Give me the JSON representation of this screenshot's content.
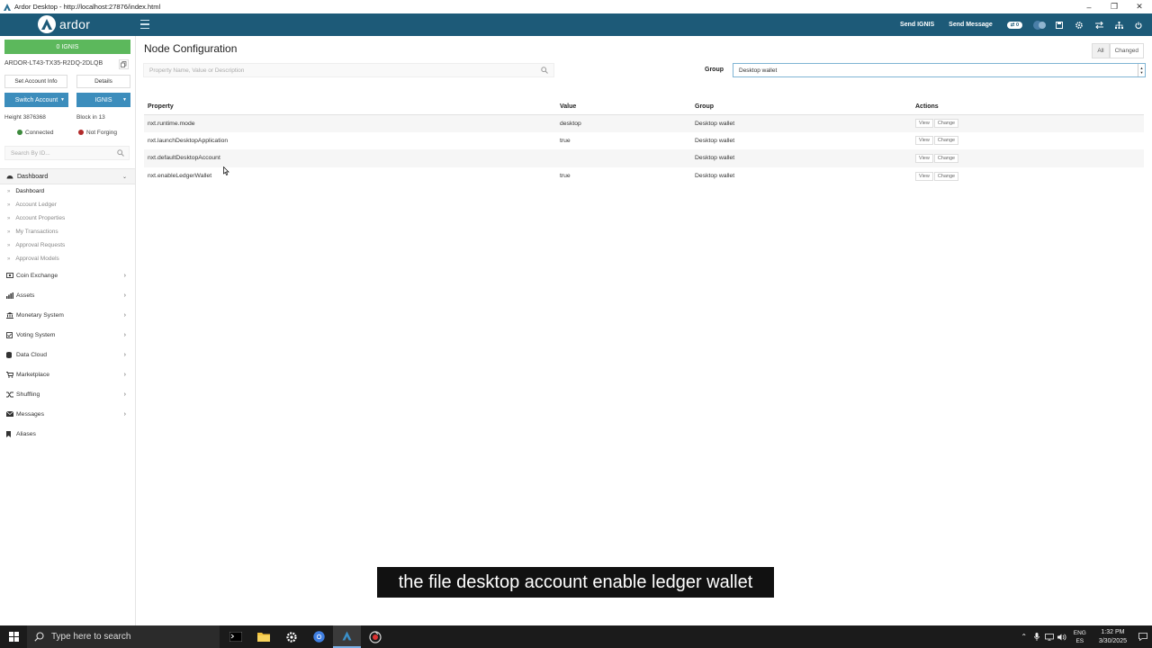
{
  "window": {
    "title": "Ardor Desktop - http://localhost:27876/index.html"
  },
  "navbar": {
    "brand": "ardor",
    "send_ignis": "Send IGNIS",
    "send_message": "Send Message",
    "badge": "0"
  },
  "sidebar": {
    "balance": "0 IGNIS",
    "account": "ARDOR-LT43-TX35-R2DQ-2DLQB",
    "set_account_info": "Set Account Info",
    "details": "Details",
    "switch_account": "Switch Account",
    "chain": "IGNIS",
    "height": "Height 3876368",
    "block_in": "Block in 13",
    "connected": "Connected",
    "not_forging": "Not Forging",
    "search_placeholder": "Search By ID...",
    "dashboard_head": "Dashboard",
    "dashboard_items": [
      "Dashboard",
      "Account Ledger",
      "Account Properties",
      "My Transactions",
      "Approval Requests",
      "Approval Models"
    ],
    "menu": [
      {
        "label": "Coin Exchange",
        "icon": "exchange-icon"
      },
      {
        "label": "Assets",
        "icon": "bar-chart-icon"
      },
      {
        "label": "Monetary System",
        "icon": "bank-icon"
      },
      {
        "label": "Voting System",
        "icon": "checkbox-icon"
      },
      {
        "label": "Data Cloud",
        "icon": "database-icon"
      },
      {
        "label": "Marketplace",
        "icon": "cart-icon"
      },
      {
        "label": "Shuffling",
        "icon": "shuffle-icon"
      },
      {
        "label": "Messages",
        "icon": "envelope-icon"
      },
      {
        "label": "Aliases",
        "icon": "bookmark-icon"
      }
    ]
  },
  "main": {
    "title": "Node Configuration",
    "filter_all": "All",
    "filter_changed": "Changed",
    "search_placeholder": "Property Name, Value or Description",
    "group_label": "Group",
    "group_value": "Desktop wallet",
    "columns": {
      "property": "Property",
      "value": "Value",
      "group": "Group",
      "actions": "Actions"
    },
    "view_label": "View",
    "change_label": "Change",
    "rows": [
      {
        "property": "nxt.runtime.mode",
        "value": "desktop",
        "group": "Desktop wallet"
      },
      {
        "property": "nxt.launchDesktopApplication",
        "value": "true",
        "group": "Desktop wallet"
      },
      {
        "property": "nxt.defaultDesktopAccount",
        "value": "",
        "group": "Desktop wallet"
      },
      {
        "property": "nxt.enableLedgerWallet",
        "value": "true",
        "group": "Desktop wallet"
      }
    ]
  },
  "caption": "the file desktop account enable ledger wallet",
  "taskbar": {
    "search_placeholder": "Type here to search",
    "lang_top": "ENG",
    "lang_bottom": "ES",
    "time": "1:32 PM",
    "date": "3/30/2025"
  }
}
